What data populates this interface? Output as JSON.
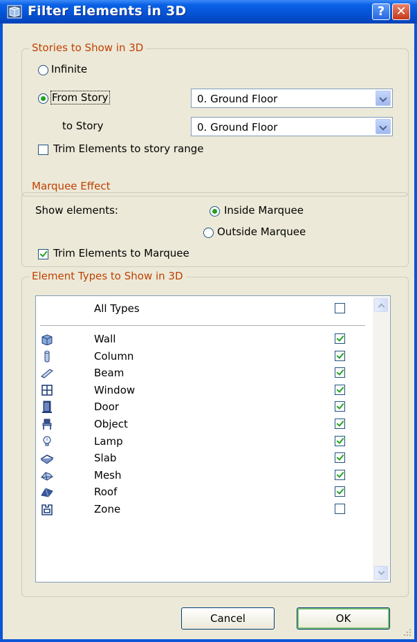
{
  "window": {
    "title": "Filter Elements in 3D",
    "help_label": "?",
    "close_label": "✕"
  },
  "stories": {
    "legend": "Stories to Show in 3D",
    "infinite_label": "Infinite",
    "from_story_label": "From Story",
    "from_story_value": "0. Ground Floor",
    "to_story_label": "to Story",
    "to_story_value": "0. Ground Floor",
    "trim_label": "Trim Elements to story range",
    "selected": "from_story",
    "trim_checked": false
  },
  "marquee": {
    "legend": "Marquee Effect",
    "show_label": "Show elements:",
    "inside_label": "Inside Marquee",
    "outside_label": "Outside Marquee",
    "selected": "inside",
    "trim_label": "Trim Elements to Marquee",
    "trim_checked": true
  },
  "types": {
    "legend": "Element Types to Show in 3D",
    "all_label": "All Types",
    "all_checked": false,
    "items": [
      {
        "label": "Wall",
        "icon": "wall-icon",
        "checked": true
      },
      {
        "label": "Column",
        "icon": "column-icon",
        "checked": true
      },
      {
        "label": "Beam",
        "icon": "beam-icon",
        "checked": true
      },
      {
        "label": "Window",
        "icon": "window-icon",
        "checked": true
      },
      {
        "label": "Door",
        "icon": "door-icon",
        "checked": true
      },
      {
        "label": "Object",
        "icon": "object-icon",
        "checked": true
      },
      {
        "label": "Lamp",
        "icon": "lamp-icon",
        "checked": true
      },
      {
        "label": "Slab",
        "icon": "slab-icon",
        "checked": true
      },
      {
        "label": "Mesh",
        "icon": "mesh-icon",
        "checked": true
      },
      {
        "label": "Roof",
        "icon": "roof-icon",
        "checked": true
      },
      {
        "label": "Zone",
        "icon": "zone-icon",
        "checked": false
      }
    ]
  },
  "buttons": {
    "cancel": "Cancel",
    "ok": "OK"
  },
  "colors": {
    "titlebar": "#0552d4",
    "dialog_bg": "#ece9d8",
    "group_legend": "#c04000",
    "check_mark": "#21a121"
  }
}
